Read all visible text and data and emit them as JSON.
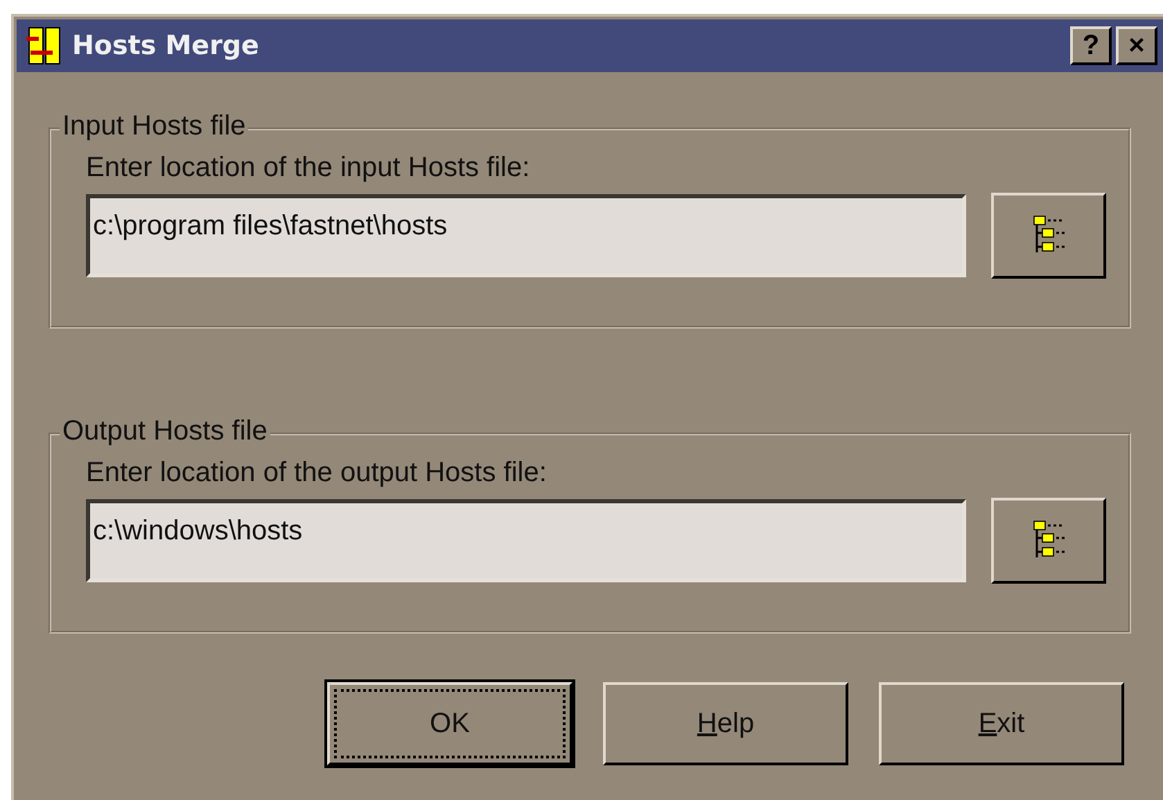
{
  "window": {
    "title": "Hosts Merge",
    "title_buttons": [
      "?",
      "×"
    ]
  },
  "groups": [
    {
      "title": "Input Hosts file",
      "prompt": "Enter location of the input Hosts file:",
      "value": "c:\\program files\\fastnet\\hosts"
    },
    {
      "title": "Output Hosts file",
      "prompt": "Enter location of the output Hosts file:",
      "value": "c:\\windows\\hosts"
    }
  ],
  "buttons": [
    {
      "label": "OK",
      "focused": true,
      "first_letter_underlined": false
    },
    {
      "label": "Help",
      "focused": false,
      "first_letter_underlined": true
    },
    {
      "label": "Exit",
      "focused": false,
      "first_letter_underlined": true
    }
  ]
}
